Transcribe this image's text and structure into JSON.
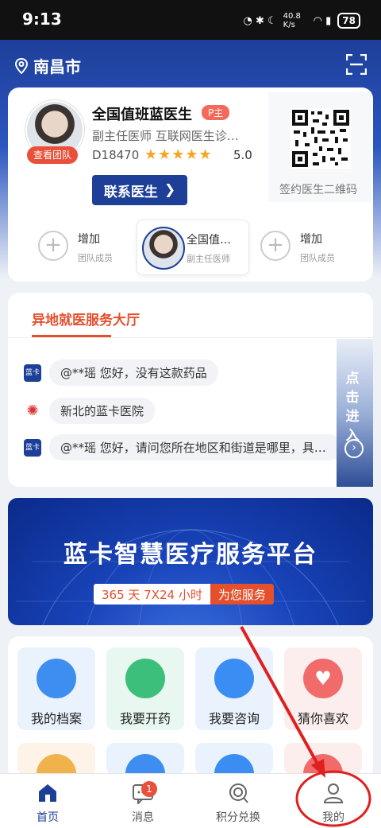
{
  "status_bar": {
    "time": "9:13",
    "speed": "40.8 K/s",
    "battery": "78"
  },
  "header": {
    "city": "南昌市"
  },
  "doctor": {
    "name": "全国值班蓝医生",
    "tag": "P主",
    "title": "副主任医师  互联网医生诊…",
    "id": "D18470",
    "stars": "★★★★★",
    "rating": "5.0",
    "team_button": "查看团队",
    "contact_button": "联系医生",
    "qr_label": "签约医生二维码"
  },
  "team": [
    {
      "t1": "增加",
      "t2": "团队成员"
    },
    {
      "t1": "全国值…",
      "t2": "副主任医师"
    },
    {
      "t1": "增加",
      "t2": "团队成员"
    }
  ],
  "hall": {
    "title": "异地就医服务大厅",
    "enter": "点击进入",
    "messages": [
      {
        "text": "@**瑶 您好，没有这款药品"
      },
      {
        "text": "新北的蓝卡医院"
      },
      {
        "text": "@**瑶 您好，请问您所在地区和街道是哪里，具…"
      }
    ]
  },
  "banner": {
    "title": "蓝卡智慧医疗服务平台",
    "sub_a": "365 天 7X24 小时",
    "sub_b": "为您服务"
  },
  "grid": [
    {
      "label": "我的档案",
      "color": "#3d8ef0",
      "bg": "#eaf2fd"
    },
    {
      "label": "我要开药",
      "color": "#3cbf7a",
      "bg": "#e8f7ef"
    },
    {
      "label": "我要咨询",
      "color": "#3a8df2",
      "bg": "#eaf2fd"
    },
    {
      "label": "猜你喜欢",
      "color": "#f26b6b",
      "bg": "#fdeeee"
    }
  ],
  "nav": [
    {
      "label": "首页",
      "active": true
    },
    {
      "label": "消息",
      "badge": "1"
    },
    {
      "label": "积分兑换"
    },
    {
      "label": "我的"
    }
  ],
  "colors": {
    "primary": "#1d3f98",
    "accent": "#e4502c",
    "star": "#f5a623",
    "annotation": "#e02020"
  }
}
